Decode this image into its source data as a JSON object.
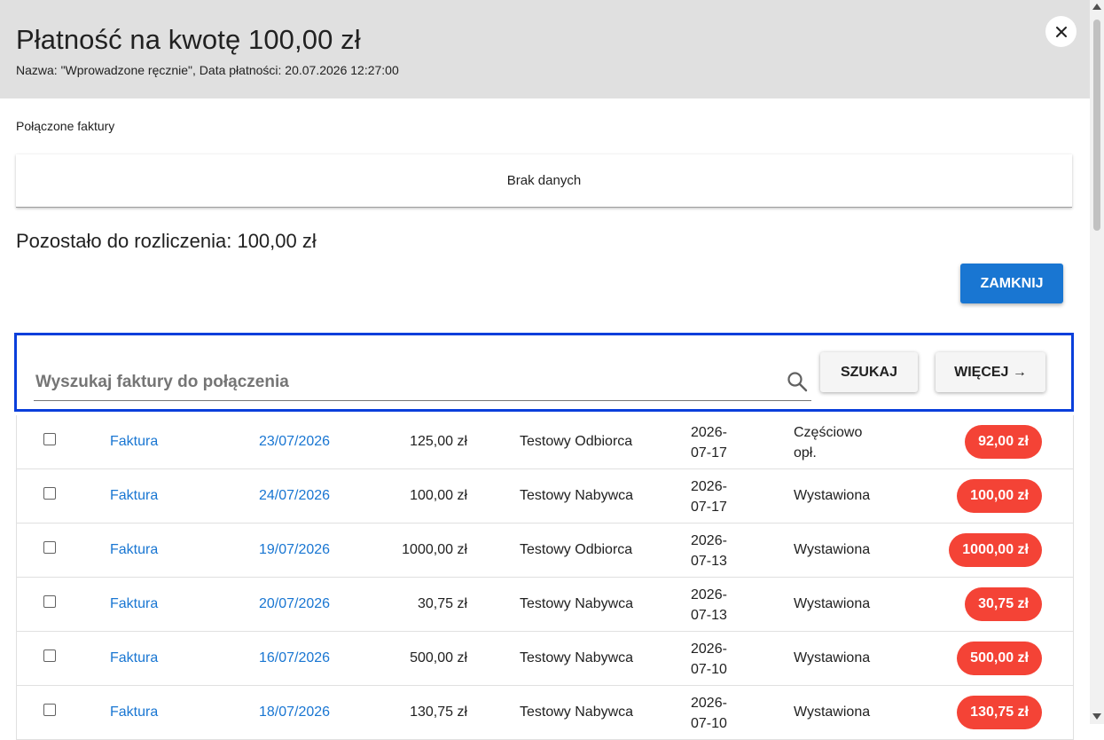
{
  "dialog": {
    "title": "Płatność na kwotę 100,00 zł",
    "subtitle": "Nazwa: \"Wprowadzone ręcznie\", Data płatności: 20.07.2026 12:27:00",
    "close_icon": "close-icon"
  },
  "linked": {
    "label": "Połączone faktury",
    "empty_text": "Brak danych"
  },
  "remaining": "Pozostało do rozliczenia: 100,00 zł",
  "buttons": {
    "close": "ZAMKNIJ",
    "search": "SZUKAJ",
    "more": "WIĘCEJ →"
  },
  "search": {
    "placeholder": "Wyszukaj faktury do połączenia",
    "value": "",
    "icon": "search-icon"
  },
  "colors": {
    "primary": "#1976d2",
    "badge": "#f44336",
    "search_border": "#0a3fdb",
    "header_bg": "#e0e0e0"
  },
  "invoices": [
    {
      "type": "Faktura",
      "date": "23/07/2026",
      "amount": "125,00 zł",
      "party": "Testowy Odbiorca",
      "issue_line1": "2026-",
      "issue_line2": "07-17",
      "status": "Częściowo opł.",
      "badge": "92,00 zł"
    },
    {
      "type": "Faktura",
      "date": "24/07/2026",
      "amount": "100,00 zł",
      "party": "Testowy Nabywca",
      "issue_line1": "2026-",
      "issue_line2": "07-17",
      "status": "Wystawiona",
      "badge": "100,00 zł"
    },
    {
      "type": "Faktura",
      "date": "19/07/2026",
      "amount": "1000,00 zł",
      "party": "Testowy Odbiorca",
      "issue_line1": "2026-",
      "issue_line2": "07-13",
      "status": "Wystawiona",
      "badge": "1000,00 zł"
    },
    {
      "type": "Faktura",
      "date": "20/07/2026",
      "amount": "30,75 zł",
      "party": "Testowy Nabywca",
      "issue_line1": "2026-",
      "issue_line2": "07-13",
      "status": "Wystawiona",
      "badge": "30,75 zł"
    },
    {
      "type": "Faktura",
      "date": "16/07/2026",
      "amount": "500,00 zł",
      "party": "Testowy Nabywca",
      "issue_line1": "2026-",
      "issue_line2": "07-10",
      "status": "Wystawiona",
      "badge": "500,00 zł"
    },
    {
      "type": "Faktura",
      "date": "18/07/2026",
      "amount": "130,75 zł",
      "party": "Testowy Nabywca",
      "issue_line1": "2026-",
      "issue_line2": "07-10",
      "status": "Wystawiona",
      "badge": "130,75 zł"
    }
  ]
}
